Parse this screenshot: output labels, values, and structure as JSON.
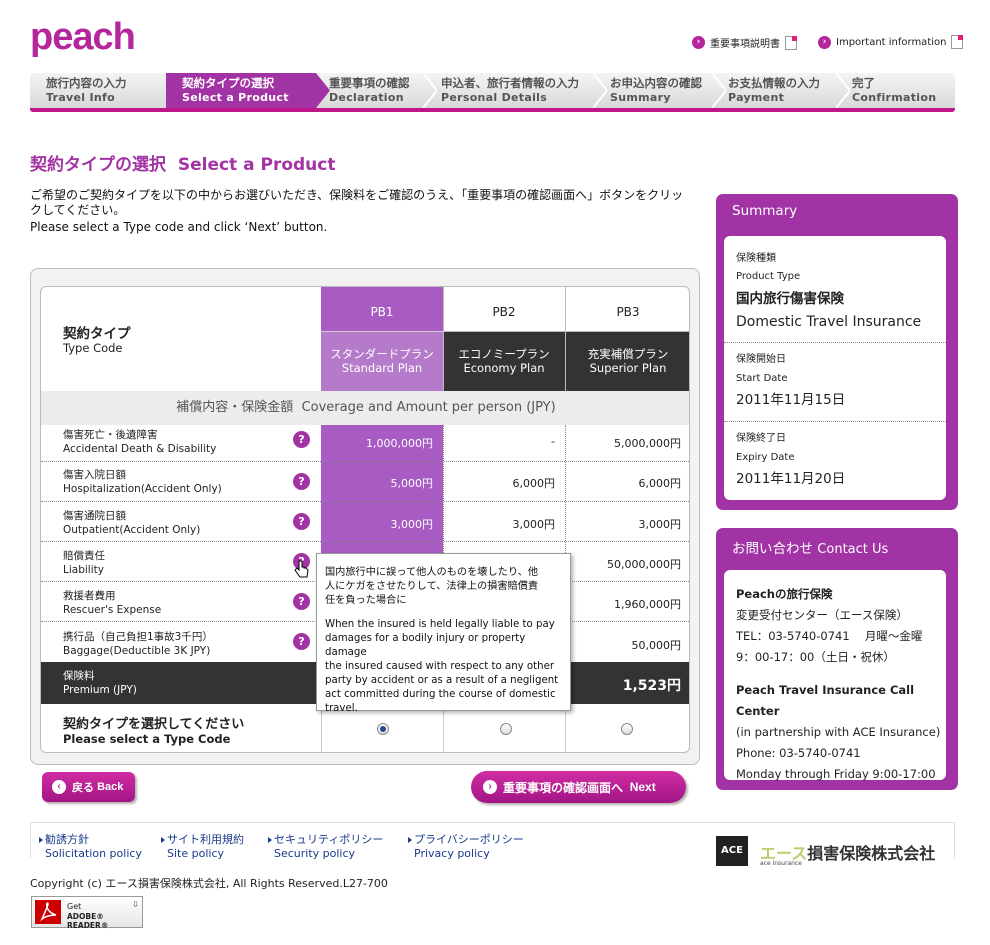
{
  "header": {
    "logo": "peach",
    "link_jp": "重要事項説明書",
    "link_en": "Important information"
  },
  "steps": [
    {
      "jp": "旅行内容の入力",
      "en": "Travel Info"
    },
    {
      "jp": "契約タイプの選択",
      "en": "Select a Product"
    },
    {
      "jp": "重要事項の確認",
      "en": "Declaration"
    },
    {
      "jp": "申込者、旅行者情報の入力",
      "en": "Personal Details"
    },
    {
      "jp": "お申込内容の確認",
      "en": "Summary"
    },
    {
      "jp": "お支払情報の入力",
      "en": "Payment"
    },
    {
      "jp": "完了",
      "en": "Confirmation"
    }
  ],
  "page": {
    "title_jp": "契約タイプの選択",
    "title_en": "Select a Product",
    "intro_jp_1": "ご希望のご契約タイプを以下の中からお選びいただき、保険料をご確認のうえ、「重要事項の確認画面へ」ボタンをクリッ",
    "intro_jp_2": "クしてください。",
    "intro_en": "Please select a Type code and click ‘Next’ button."
  },
  "table": {
    "type_code_jp": "契約タイプ",
    "type_code_en": "Type Code",
    "plans": [
      {
        "code": "PB1",
        "jp": "スタンダードプラン",
        "en": "Standard Plan"
      },
      {
        "code": "PB2",
        "jp": "エコノミープラン",
        "en": "Economy Plan"
      },
      {
        "code": "PB3",
        "jp": "充実補償プラン",
        "en": "Superior Plan"
      }
    ],
    "coverage_jp": "補償内容・保険金額",
    "coverage_en": "Coverage and Amount per person (JPY)",
    "rows": [
      {
        "jp": "傷害死亡・後遺障害",
        "en": "Accidental Death & Disability",
        "v": [
          "1,000,000円",
          "-",
          "5,000,000円"
        ]
      },
      {
        "jp": "傷害入院日額",
        "en": "Hospitalization(Accident Only)",
        "v": [
          "5,000円",
          "6,000円",
          "6,000円"
        ]
      },
      {
        "jp": "傷害通院日額",
        "en": "Outpatient(Accident Only)",
        "v": [
          "3,000円",
          "3,000円",
          "3,000円"
        ]
      },
      {
        "jp": "賠償責任",
        "en": "Liability",
        "v": [
          "",
          "",
          "50,000,000円"
        ]
      },
      {
        "jp": "救援者費用",
        "en": "Rescuer's Expense",
        "v": [
          "",
          "",
          "1,960,000円"
        ]
      },
      {
        "jp": "携行品（自己負担1事故3千円）",
        "en": "Baggage(Deductible 3K JPY)",
        "v": [
          "",
          "",
          "50,000円"
        ]
      }
    ],
    "premium_jp": "保険料",
    "premium_en": "Premium (JPY)",
    "premium_values": [
      "",
      "",
      "1,523円"
    ],
    "select_jp": "契約タイプを選択してください",
    "select_en": "Please select a Type Code"
  },
  "tooltip": {
    "jp_1": "国内旅行中に誤って他人のものを壊したり、他",
    "jp_2": "人にケガをさせたりして、法律上の損害賠償責",
    "jp_3": "任を負った場合に",
    "en_1": "When the insured is held legally liable to pay",
    "en_2": "damages for a bodily injury or property damage",
    "en_3": "the insured caused with respect to any other",
    "en_4": "party by accident or as a result of a negligent",
    "en_5": "act committed during the course of domestic",
    "en_6": "travel."
  },
  "buttons": {
    "back_jp": "戻る",
    "back_en": "Back",
    "next_jp": "重要事項の確認画面へ",
    "next_en": "Next"
  },
  "summary": {
    "head": "Summary",
    "type_jp": "保険種類",
    "type_en": "Product Type",
    "type_val_jp": "国内旅行傷害保険",
    "type_val_en": "Domestic Travel Insurance",
    "start_jp": "保険開始日",
    "start_en": "Start Date",
    "start_val": "2011年11月15日",
    "end_jp": "保険終了日",
    "end_en": "Expiry Date",
    "end_val": "2011年11月20日"
  },
  "contact": {
    "head_jp": "お問い合わせ",
    "head_en": "Contact Us",
    "l1": "Peachの旅行保険",
    "l2": "変更受付センター（エース保険）",
    "l3": "TEL：03-5740-0741　 月曜～金曜",
    "l4": "9：00-17：00（土日・祝休）",
    "l5": "Peach Travel Insurance Call Center",
    "l6": "(in partnership with ACE Insurance)",
    "l7": "Phone: 03-5740-0741",
    "l8": "Monday through Friday 9:00-17:00"
  },
  "footer": {
    "links": [
      {
        "jp": "勧誘方針",
        "en": "Solicitation policy"
      },
      {
        "jp": "サイト利用規約",
        "en": "Site policy"
      },
      {
        "jp": "セキュリティポリシー",
        "en": "Security policy"
      },
      {
        "jp": "プライバシーポリシー",
        "en": "Privacy policy"
      }
    ],
    "ace_logo": "ACE",
    "ace_sub": "ace insurance",
    "company_ace": "エース",
    "company_rest": "損害保険株式会社",
    "copyright": "Copyright (c) エース損害保険株式会社, All Rights Reserved.L27-700",
    "adobe_get": "Get",
    "adobe_name": "ADOBE® READER®"
  },
  "colors": {
    "brand": "#b5259b",
    "accent": "#a233a4",
    "dark": "#333333"
  }
}
